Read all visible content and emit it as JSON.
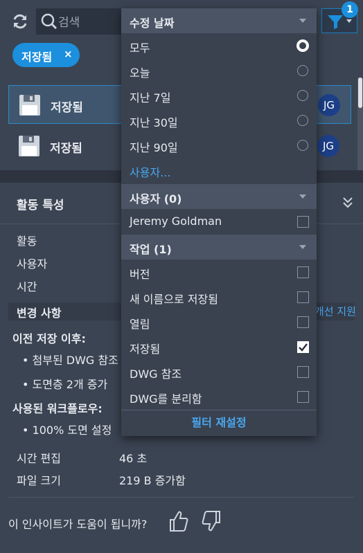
{
  "search": {
    "placeholder": "검색"
  },
  "filter": {
    "badge": "1"
  },
  "chip": {
    "label": "저장됨",
    "close": "×"
  },
  "history": [
    {
      "label": "저장됨",
      "avatar": "JG"
    },
    {
      "label": "저장됨",
      "avatar": "JG"
    }
  ],
  "details": {
    "title": "활동 특성",
    "rows": [
      {
        "label": "활동",
        "value": ""
      },
      {
        "label": "사용자",
        "value": ""
      },
      {
        "label": "시간",
        "value": ""
      }
    ],
    "changes_title": "변경 사항",
    "support_link": "개선 지원",
    "since_last_save": "이전 저장 이후:",
    "since_bullets": [
      "첨부된 DWG 참조",
      "도면층 2개 증가"
    ],
    "workflow_title": "사용된 워크플로우:",
    "workflow_bullets": [
      "100% 도면 설정"
    ],
    "time_edit_label": "시간 편집",
    "time_edit_value": "46 초",
    "file_size_label": "파일 크기",
    "file_size_value": "219 B 증가함",
    "feedback": "이 인사이트가 도움이 됩니까?"
  },
  "dropdown": {
    "date_header": "수정 날짜",
    "date_options": [
      "모두",
      "오늘",
      "지난 7일",
      "지난 30일",
      "지난 90일"
    ],
    "date_selected": "모두",
    "user_link": "사용자...",
    "user_header": "사용자 (0)",
    "users": [
      "Jeremy Goldman"
    ],
    "action_header": "작업 (1)",
    "actions": [
      {
        "label": "버전",
        "checked": false
      },
      {
        "label": "새 이름으로 저장됨",
        "checked": false
      },
      {
        "label": "열림",
        "checked": false
      },
      {
        "label": "저장됨",
        "checked": true
      },
      {
        "label": "DWG 참조",
        "checked": false
      },
      {
        "label": "DWG를 분리함",
        "checked": false
      }
    ],
    "reset": "필터 재설정"
  },
  "colors": {
    "accent": "#1c8fdd",
    "panel": "#3b4453",
    "dropdown": "#3a4250",
    "link": "#4aa7ee"
  }
}
